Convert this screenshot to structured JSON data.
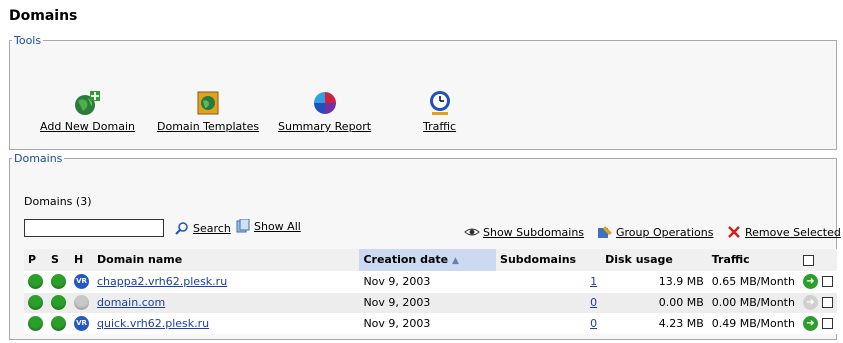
{
  "page": {
    "title": "Domains"
  },
  "tools": {
    "legend": "Tools",
    "items": [
      {
        "label": "Add New Domain",
        "icon": "add-domain-icon"
      },
      {
        "label": "Domain Templates",
        "icon": "domain-templates-icon"
      },
      {
        "label": "Summary Report",
        "icon": "summary-report-icon"
      },
      {
        "label": "Traffic",
        "icon": "traffic-icon"
      }
    ]
  },
  "domains": {
    "legend": "Domains",
    "count_label": "Domains (3)",
    "search": {
      "value": "",
      "button": "Search",
      "show_all": "Show All"
    },
    "actions": {
      "show_subdomains": "Show Subdomains",
      "group_operations": "Group Operations",
      "remove_selected": "Remove Selected"
    },
    "columns": {
      "p": "P",
      "s": "S",
      "h": "H",
      "name": "Domain name",
      "created": "Creation date",
      "subdomains": "Subdomains",
      "disk": "Disk usage",
      "traffic": "Traffic"
    },
    "rows": [
      {
        "name": "chappa2.vrh62.plesk.ru",
        "created": "Nov 9, 2003",
        "subdomains": "1",
        "disk": "13.9 MB",
        "traffic": "0.65 MB/Month",
        "hosting": "vr"
      },
      {
        "name": "domain.com",
        "created": "Nov 9, 2003",
        "subdomains": "0",
        "disk": "0.00 MB",
        "traffic": "0.00 MB/Month",
        "hosting": "none"
      },
      {
        "name": "quick.vrh62.plesk.ru",
        "created": "Nov 9, 2003",
        "subdomains": "0",
        "disk": "4.23 MB",
        "traffic": "0.49 MB/Month",
        "hosting": "vr"
      }
    ],
    "hosting_badge": "VR"
  },
  "colors": {
    "link": "#1a3fa8",
    "legend": "#1c4fa0",
    "sorted_header": "#ccd9f2",
    "status_ok": "#2aa02a"
  }
}
